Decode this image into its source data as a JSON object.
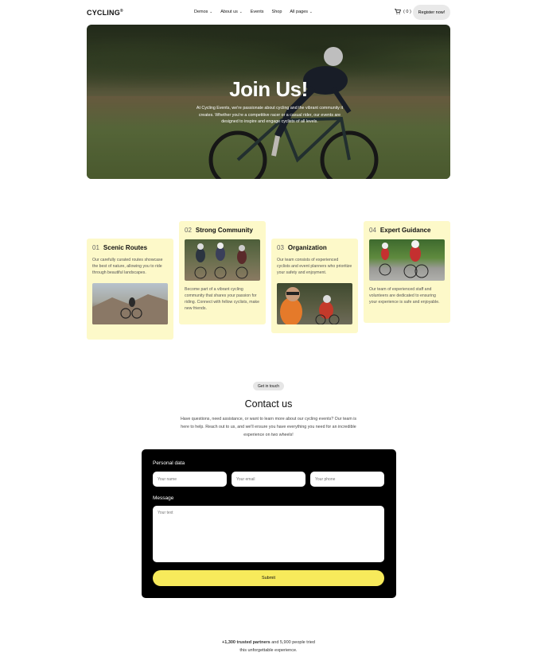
{
  "header": {
    "logo": "CYCLING",
    "logo_mark": "®",
    "nav": [
      {
        "label": "Demos",
        "has_dropdown": true
      },
      {
        "label": "About us",
        "has_dropdown": true
      },
      {
        "label": "Events",
        "has_dropdown": false
      },
      {
        "label": "Shop",
        "has_dropdown": false
      },
      {
        "label": "All pages",
        "has_dropdown": true
      }
    ],
    "cart_count": "( 0 )",
    "register_label": "Register now!"
  },
  "hero": {
    "title": "Join Us!",
    "text": "At Cycling Events, we're passionate about cycling and the vibrant community it creates. Whether you're a competitive racer or a casual rider, our events are designed to inspire and engage cyclists of all levels."
  },
  "features": [
    {
      "num": "01",
      "title": "Scenic Routes",
      "text": "Our carefully curated routes showcase the best of nature, allowing you to ride through beautiful landscapes."
    },
    {
      "num": "02",
      "title": "Strong Community",
      "text": "Become part of a vibrant cycling community that shares your passion for riding. Connect with fellow cyclists, make new friends."
    },
    {
      "num": "03",
      "title": "Organization",
      "text": "Our team consists of experienced cyclists and event planners who prioritize your safety and enjoyment."
    },
    {
      "num": "04",
      "title": "Expert Guidance",
      "text": "Our team of experienced staff and volunteers are dedicated to ensuring your experience is safe and enjoyable."
    }
  ],
  "contact": {
    "pill": "Get in touch",
    "title": "Contact us",
    "text": "Have questions, need assistance, or want to learn more about our cycling events? Our team is here to help. Reach out to us, and we'll ensure you have everything you need for an incredible experience on two wheels!",
    "personal_label": "Personal data",
    "name_placeholder": "Your name",
    "email_placeholder": "Your email",
    "phone_placeholder": "Your phone",
    "message_label": "Message",
    "message_placeholder": "Your text",
    "submit_label": "Submit"
  },
  "partners": {
    "bold": "+1,300 trusted partners",
    "rest": " and 5,900 people tried",
    "line2": "this unforgettable experience."
  }
}
